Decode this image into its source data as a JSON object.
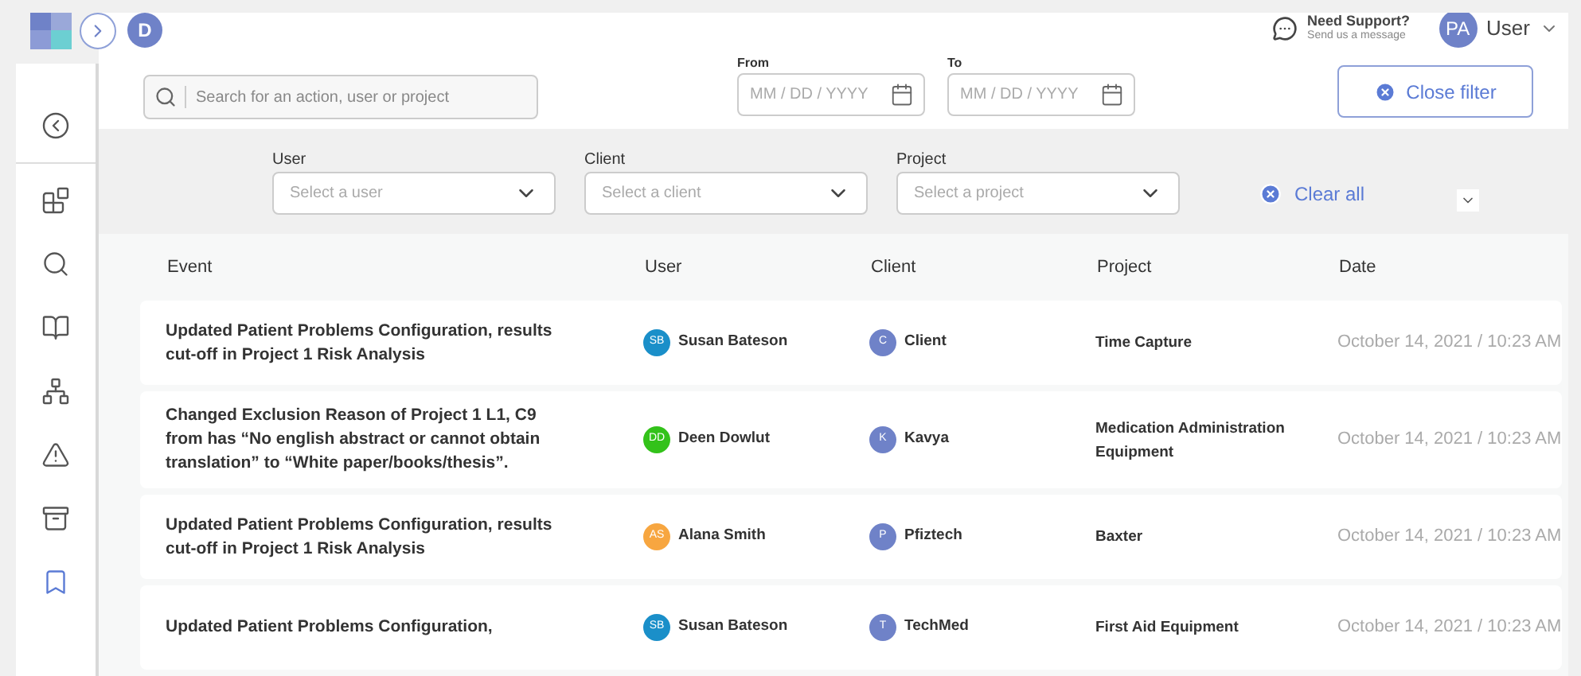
{
  "header": {
    "workspace_initial": "D",
    "support": {
      "title": "Need Support?",
      "subtitle": "Send us a message"
    },
    "user": {
      "initials": "PA",
      "name": "User"
    }
  },
  "sidebar": {
    "items": [
      {
        "kind": "back",
        "selected": false
      },
      {
        "kind": "blocks",
        "selected": false
      },
      {
        "kind": "search",
        "selected": false
      },
      {
        "kind": "book",
        "selected": false
      },
      {
        "kind": "network",
        "selected": false
      },
      {
        "kind": "warning",
        "selected": false
      },
      {
        "kind": "cabinet",
        "selected": false
      },
      {
        "kind": "bookmark",
        "selected": true
      }
    ]
  },
  "search": {
    "placeholder": "Search for an action, user or project"
  },
  "dates": [
    {
      "label": "From",
      "placeholder": "MM / DD / YYYY"
    },
    {
      "label": "To",
      "placeholder": "MM / DD / YYYY"
    }
  ],
  "close_filter": "Close filter",
  "filters": [
    {
      "label": "User",
      "placeholder": "Select a user"
    },
    {
      "label": "Client",
      "placeholder": "Select a client"
    },
    {
      "label": "Project",
      "placeholder": "Select a project"
    }
  ],
  "clear_all": "Clear all",
  "table": {
    "columns": [
      "Event",
      "User",
      "Client",
      "Project",
      "Date"
    ],
    "rows": [
      {
        "event": "Updated Patient Problems Configuration, results cut-off in Project 1 Risk Analysis",
        "user": {
          "initials": "SB",
          "name": "Susan Bateson",
          "color": "#1a8fc9"
        },
        "client": {
          "initial": "C",
          "name": "Client"
        },
        "project": "Time Capture",
        "date": "October 14, 2021 / 10:23 AM"
      },
      {
        "event": "Changed Exclusion Reason of Project 1 L1, C9 from has “No english abstract or cannot obtain translation” to “White paper/books/thesis”.",
        "user": {
          "initials": "DD",
          "name": "Deen Dowlut",
          "color": "#33c21a"
        },
        "client": {
          "initial": "K",
          "name": "Kavya"
        },
        "project": "Medication Administration Equipment",
        "date": "October 14, 2021 / 10:23 AM"
      },
      {
        "event": "Updated Patient Problems Configuration, results cut-off in Project 1 Risk Analysis",
        "user": {
          "initials": "AS",
          "name": "Alana Smith",
          "color": "#f7a640"
        },
        "client": {
          "initial": "P",
          "name": "Pfiztech"
        },
        "project": "Baxter",
        "date": "October 14, 2021 / 10:23 AM"
      },
      {
        "event": "Updated Patient Problems Configuration,",
        "user": {
          "initials": "SB",
          "name": "Susan Bateson",
          "color": "#1a8fc9"
        },
        "client": {
          "initial": "T",
          "name": "TechMed"
        },
        "project": "First Aid Equipment",
        "date": "October 14, 2021 / 10:23 AM"
      }
    ]
  }
}
